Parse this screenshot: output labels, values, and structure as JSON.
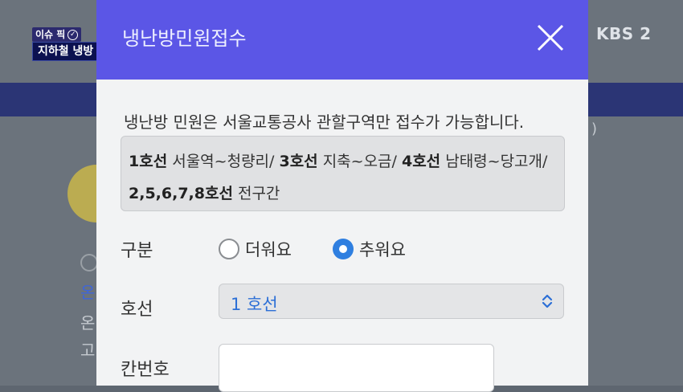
{
  "broadcast": {
    "tag": "이슈 픽",
    "caption": "지하철 냉방 명당은?",
    "logo": "KBS 2"
  },
  "background": {
    "fragment_1": "온",
    "fragment_2": "온",
    "fragment_3": "고",
    "fragment_paren": ")"
  },
  "modal": {
    "title": "냉난방민원접수",
    "notice": "냉난방 민원은 서울교통공사 관할구역만 접수가 가능합니다.",
    "lines": {
      "line1_name": "1호선",
      "line1_range": " 서울역~청량리/ ",
      "line3_name": "3호선",
      "line3_range": " 지축~오금/ ",
      "line4_name": "4호선",
      "line4_range": " 남태령~당고개/",
      "line5_name": "2,5,6,7,8호선",
      "line5_range": " 전구간"
    },
    "category": {
      "label": "구분",
      "options": [
        "더워요",
        "추워요"
      ],
      "selected": "추워요"
    },
    "line_select": {
      "label": "호선",
      "value": "1 호선"
    },
    "car_number": {
      "label": "칸번호",
      "value": ""
    }
  },
  "colors": {
    "header": "#5b56e6",
    "accent_blue": "#2f7fe0"
  },
  "icons": {
    "close": "close-icon",
    "select_arrows": "chevron-up-down-icon",
    "tag_check": "check-circle-icon"
  }
}
